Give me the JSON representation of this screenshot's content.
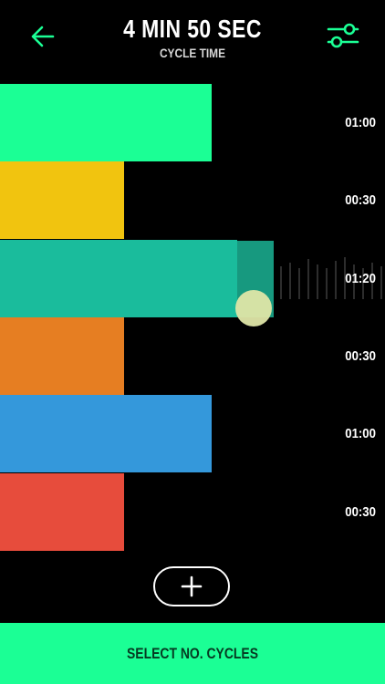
{
  "header": {
    "title": "4 MIN 50 SEC",
    "subtitle": "CYCLE TIME",
    "back_icon": "arrow-left-icon",
    "settings_icon": "sliders-icon",
    "accent": "#1bff95"
  },
  "segments": [
    {
      "time": "01:00",
      "color": "#1bff95"
    },
    {
      "time": "00:30",
      "color": "#f1c40f"
    },
    {
      "time": "01:20",
      "color": "#1abc9c"
    },
    {
      "time": "00:30",
      "color": "#e67e22"
    },
    {
      "time": "01:00",
      "color": "#3498db"
    },
    {
      "time": "00:30",
      "color": "#e74c3c"
    }
  ],
  "add_button": {
    "icon": "plus-icon"
  },
  "footer": {
    "label": "SELECT NO. CYCLES",
    "color": "#1bff95"
  }
}
